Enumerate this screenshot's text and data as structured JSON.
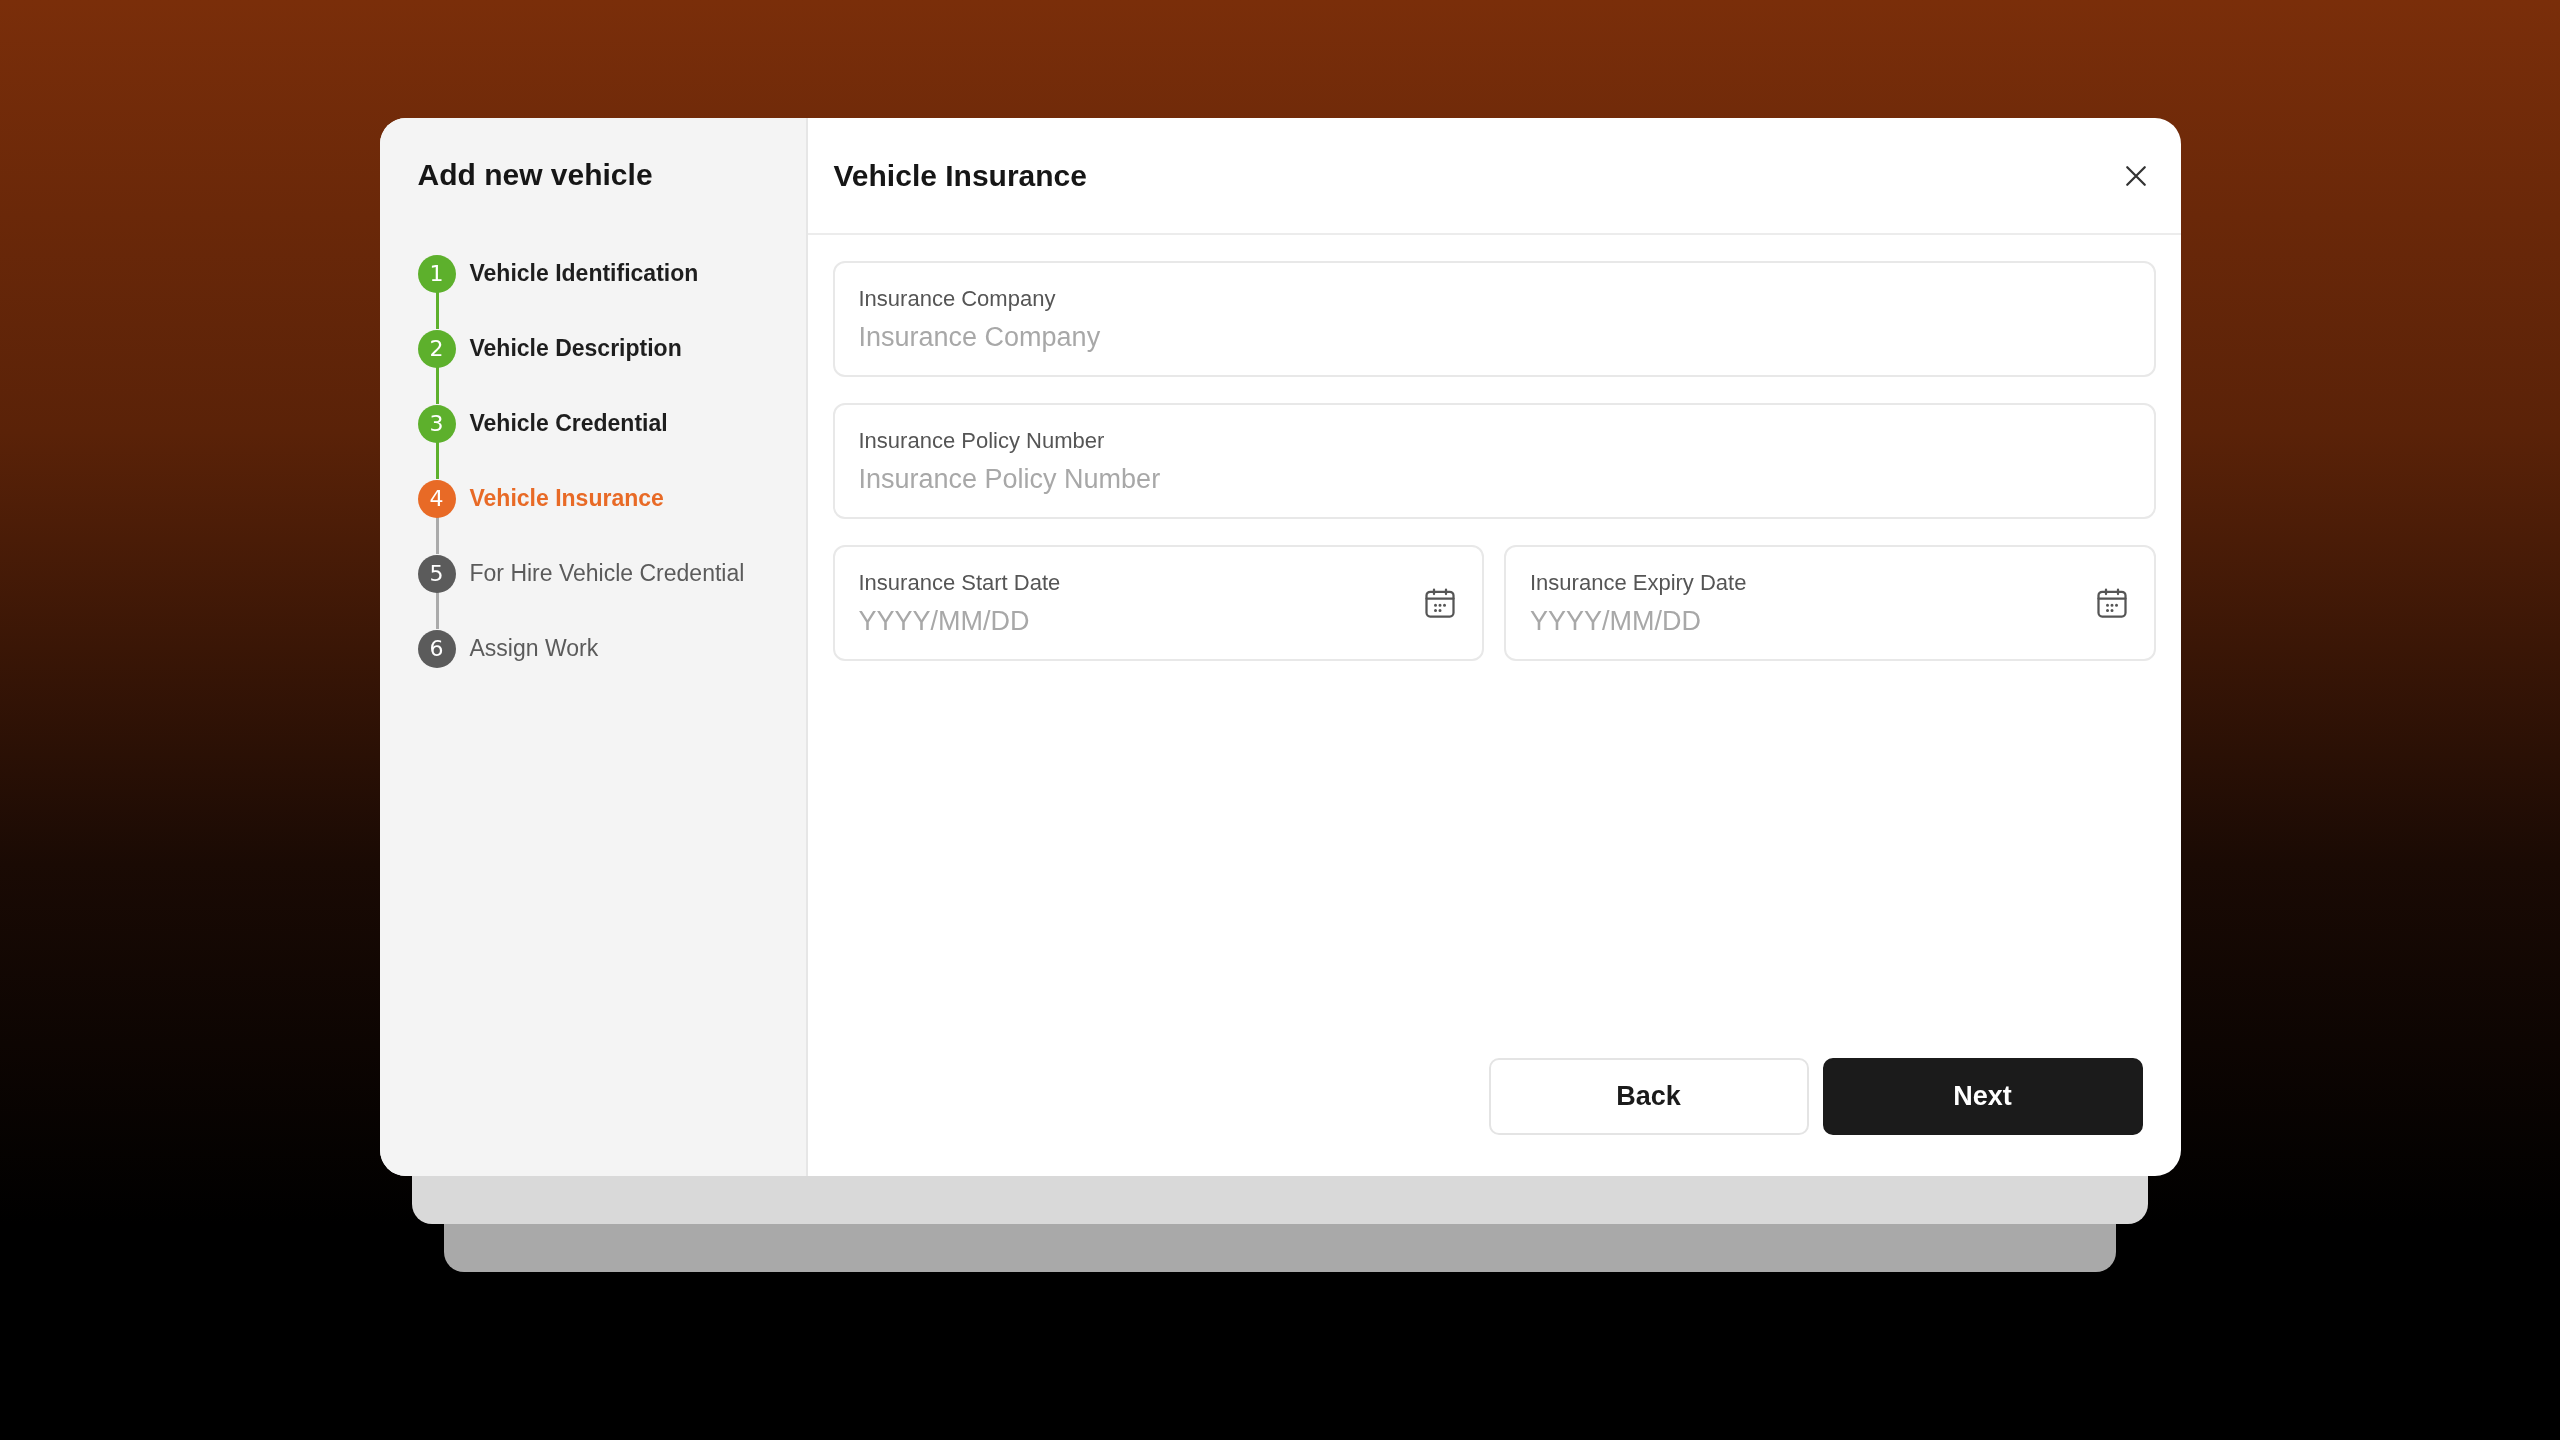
{
  "sidebar": {
    "title": "Add new vehicle",
    "steps": [
      {
        "number": "1",
        "label": "Vehicle Identification",
        "completed": true,
        "selected": false
      },
      {
        "number": "2",
        "label": "Vehicle Description",
        "completed": true,
        "selected": false
      },
      {
        "number": "3",
        "label": "Vehicle Credential",
        "completed": true,
        "selected": false
      },
      {
        "number": "4",
        "label": "Vehicle Insurance",
        "completed": false,
        "selected": true
      },
      {
        "number": "5",
        "label": "For Hire Vehicle Credential",
        "completed": false,
        "selected": false
      },
      {
        "number": "6",
        "label": "Assign Work",
        "completed": false,
        "selected": false
      }
    ]
  },
  "panel": {
    "title": "Vehicle Insurance",
    "rows": [
      [
        {
          "label": "Insurance Company",
          "placeholder": "Insurance Company",
          "kind": "text"
        }
      ],
      [
        {
          "label": "Insurance Policy Number",
          "placeholder": "Insurance Policy Number",
          "kind": "text"
        }
      ],
      [
        {
          "label": "Insurance Start Date",
          "placeholder": "YYYY/MM/DD",
          "kind": "date"
        },
        {
          "label": "Insurance Expiry Date",
          "placeholder": "YYYY/MM/DD",
          "kind": "date"
        }
      ]
    ],
    "buttons": [
      {
        "label": "Back",
        "kind": "secondary"
      },
      {
        "label": "Next",
        "kind": "primary"
      }
    ]
  }
}
